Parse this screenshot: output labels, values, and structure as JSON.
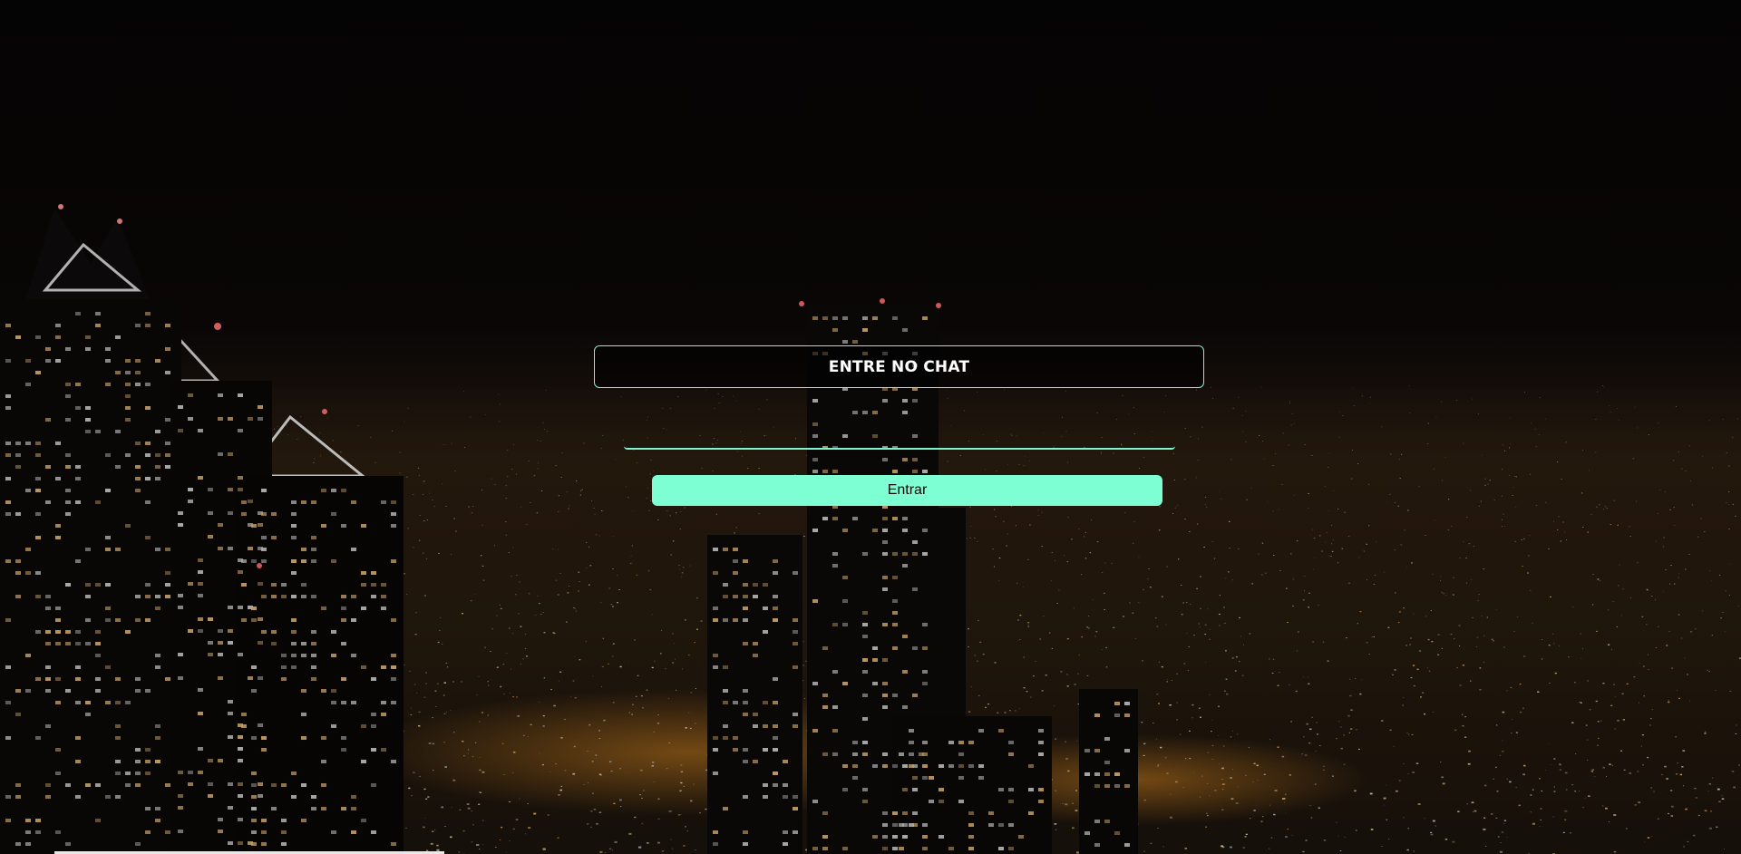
{
  "page": {
    "heading": "ENTRE NO CHAT",
    "background": "night city skyline"
  },
  "form": {
    "name_value": "",
    "name_placeholder": "",
    "submit_label": "Entrar"
  },
  "colors": {
    "accent": "#7dffd3",
    "accent_border": "#7cf5cd",
    "background": "#000000",
    "text": "#ffffff"
  }
}
